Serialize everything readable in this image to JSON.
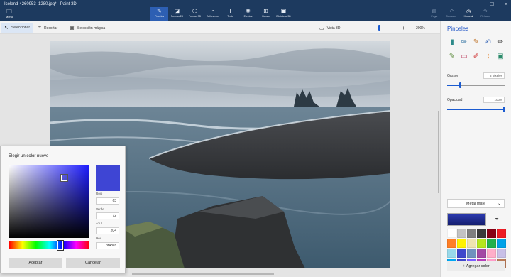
{
  "window": {
    "title": "Iceland-4260953_1280.jpg* - Paint 3D",
    "controls": [
      "—",
      "☐",
      "✕"
    ]
  },
  "menu": {
    "label": "Menú",
    "icon": "folder-icon"
  },
  "ribbon": {
    "tools": [
      {
        "label": "Pinceles",
        "icon": "brush-icon",
        "active": true
      },
      {
        "label": "Formas 2D",
        "icon": "shapes-2d-icon"
      },
      {
        "label": "Formas 3D",
        "icon": "shapes-3d-icon"
      },
      {
        "label": "Adhesivos",
        "icon": "sticker-icon"
      },
      {
        "label": "Texto",
        "icon": "text-icon"
      },
      {
        "label": "Efectos",
        "icon": "effects-icon"
      },
      {
        "label": "Lienzo",
        "icon": "canvas-icon"
      },
      {
        "label": "Biblioteca 3D",
        "icon": "library-icon"
      }
    ],
    "right_tools": [
      {
        "label": "Pegar",
        "icon": "paste-icon",
        "on": false
      },
      {
        "label": "Deshacer",
        "icon": "undo-icon",
        "on": false
      },
      {
        "label": "Historial",
        "icon": "history-icon",
        "on": true
      },
      {
        "label": "Rehacer",
        "icon": "redo-icon",
        "on": false
      }
    ]
  },
  "toolbar": {
    "select_label": "Seleccionar",
    "crop_label": "Recortar",
    "magic_label": "Selección mágica",
    "view3d_label": "Vista 3D",
    "zoom_minus": "—",
    "zoom_plus": "+",
    "zoom_value": "200%",
    "more": "···"
  },
  "color_dialog": {
    "title": "Elegir un color nuevo",
    "preview_color": "#3e45d4",
    "red_label": "Rojo",
    "red_value": "63",
    "green_label": "Verde",
    "green_value": "72",
    "blue_label": "Azul",
    "blue_value": "204",
    "hex_label": "Hex",
    "hex_value": "3f48cc",
    "accept_label": "Aceptar",
    "cancel_label": "Cancelar"
  },
  "panel": {
    "title": "Pinceles",
    "thickness_label": "Grosor",
    "thickness_value": "3 píxeles",
    "thickness_fraction": 0.22,
    "opacity_label": "Opacidad",
    "opacity_value": "100%",
    "opacity_fraction": 1.0,
    "finish": "Metal mate",
    "current_color": "#2c3ab0",
    "eyedropper_icon": "eyedropper-icon",
    "add_color_label": "Agregar color",
    "brushes": [
      {
        "icon": "marker-icon",
        "color": "#2d8a8a"
      },
      {
        "icon": "calligraphy-pen-icon",
        "color": "#2c6fa0"
      },
      {
        "icon": "oil-brush-icon",
        "color": "#c0742a"
      },
      {
        "icon": "watercolor-icon",
        "color": "#2d5fb3"
      },
      {
        "icon": "pixel-pen-icon",
        "color": "#3a3a3a"
      },
      {
        "icon": "pencil-icon",
        "color": "#5a8a3a"
      },
      {
        "icon": "eraser-icon",
        "color": "#c04a6a"
      },
      {
        "icon": "crayon-icon",
        "color": "#d03a3a"
      },
      {
        "icon": "spray-can-icon",
        "color": "#e07a20"
      },
      {
        "icon": "fill-icon",
        "color": "#2a8a6a"
      }
    ],
    "swatches": [
      "#ffffff",
      "#c3c3c3",
      "#7f7f7f",
      "#3a3a3a",
      "#880015",
      "#ed1c24",
      "#ff7f27",
      "#fff200",
      "#efe4b0",
      "#b5e61d",
      "#22b14c",
      "#00a2e8",
      "#99d9ea",
      "#3f48cc",
      "#7092be",
      "#a349a4",
      "#ffaec9",
      "#c8bfe7",
      "#00a8f3",
      "#3f48cc",
      "#7a5cff",
      "#b83dba",
      "#ff9dc9",
      "#b97a57"
    ]
  }
}
